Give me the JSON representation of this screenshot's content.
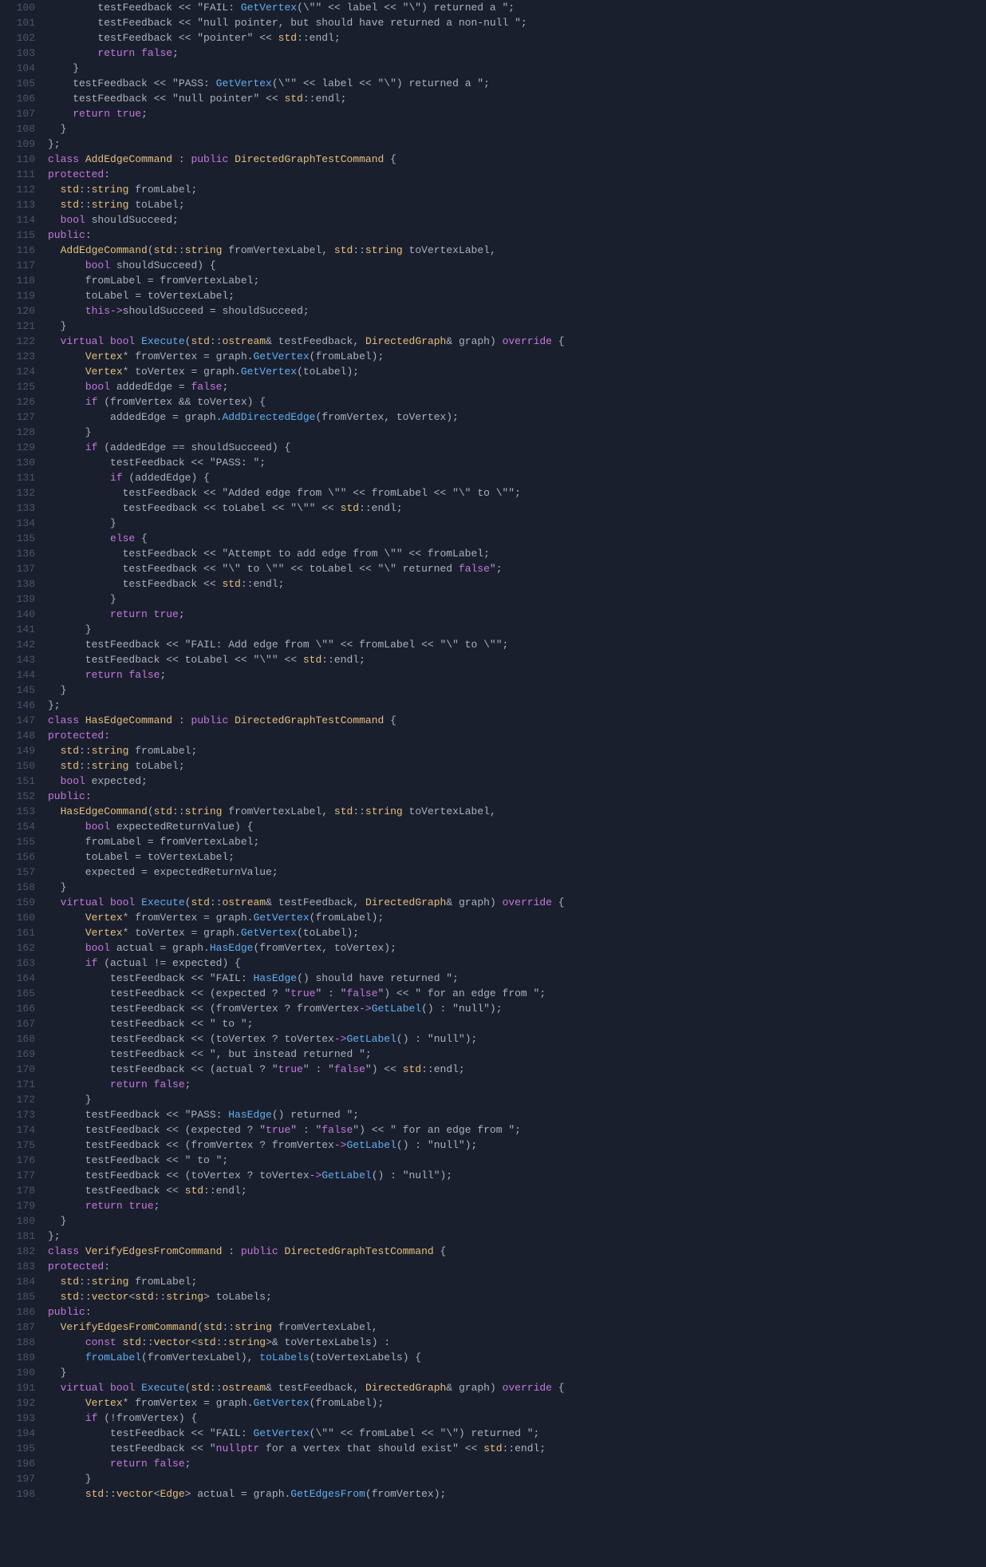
{
  "lines": [
    {
      "num": 100,
      "content": "        testFeedback << \"FAIL: GetVertex(\\\"\" << label << \"\\\") returned a \";"
    },
    {
      "num": 101,
      "content": "        testFeedback << \"null pointer, but should have returned a non-null \";"
    },
    {
      "num": 102,
      "content": "        testFeedback << \"pointer\" << std::endl;"
    },
    {
      "num": 103,
      "content": "        return false;"
    },
    {
      "num": 104,
      "content": "    }"
    },
    {
      "num": 105,
      "content": "    testFeedback << \"PASS: GetVertex(\\\"\" << label << \"\\\") returned a \";"
    },
    {
      "num": 106,
      "content": "    testFeedback << \"null pointer\" << std::endl;"
    },
    {
      "num": 107,
      "content": "    return true;"
    },
    {
      "num": 108,
      "content": "  }"
    },
    {
      "num": 109,
      "content": "};"
    },
    {
      "num": 110,
      "content": "class AddEdgeCommand : public DirectedGraphTestCommand {"
    },
    {
      "num": 111,
      "content": "protected:"
    },
    {
      "num": 112,
      "content": "  std::string fromLabel;"
    },
    {
      "num": 113,
      "content": "  std::string toLabel;"
    },
    {
      "num": 114,
      "content": "  bool shouldSucceed;"
    },
    {
      "num": 115,
      "content": "public:"
    },
    {
      "num": 116,
      "content": "  AddEdgeCommand(std::string fromVertexLabel, std::string toVertexLabel,"
    },
    {
      "num": 117,
      "content": "      bool shouldSucceed) {"
    },
    {
      "num": 118,
      "content": "      fromLabel = fromVertexLabel;"
    },
    {
      "num": 119,
      "content": "      toLabel = toVertexLabel;"
    },
    {
      "num": 120,
      "content": "      this->shouldSucceed = shouldSucceed;"
    },
    {
      "num": 121,
      "content": "  }"
    },
    {
      "num": 122,
      "content": "  virtual bool Execute(std::ostream& testFeedback, DirectedGraph& graph) override {"
    },
    {
      "num": 123,
      "content": "      Vertex* fromVertex = graph.GetVertex(fromLabel);"
    },
    {
      "num": 124,
      "content": "      Vertex* toVertex = graph.GetVertex(toLabel);"
    },
    {
      "num": 125,
      "content": "      bool addedEdge = false;"
    },
    {
      "num": 126,
      "content": "      if (fromVertex && toVertex) {"
    },
    {
      "num": 127,
      "content": "          addedEdge = graph.AddDirectedEdge(fromVertex, toVertex);"
    },
    {
      "num": 128,
      "content": "      }"
    },
    {
      "num": 129,
      "content": "      if (addedEdge == shouldSucceed) {"
    },
    {
      "num": 130,
      "content": "          testFeedback << \"PASS: \";"
    },
    {
      "num": 131,
      "content": "          if (addedEdge) {"
    },
    {
      "num": 132,
      "content": "            testFeedback << \"Added edge from \\\"\" << fromLabel << \"\\\" to \\\"\";"
    },
    {
      "num": 133,
      "content": "            testFeedback << toLabel << \"\\\"\" << std::endl;"
    },
    {
      "num": 134,
      "content": "          }"
    },
    {
      "num": 135,
      "content": "          else {"
    },
    {
      "num": 136,
      "content": "            testFeedback << \"Attempt to add edge from \\\"\" << fromLabel;"
    },
    {
      "num": 137,
      "content": "            testFeedback << \"\\\" to \\\"\" << toLabel << \"\\\" returned false\";"
    },
    {
      "num": 138,
      "content": "            testFeedback << std::endl;"
    },
    {
      "num": 139,
      "content": "          }"
    },
    {
      "num": 140,
      "content": "          return true;"
    },
    {
      "num": 141,
      "content": "      }"
    },
    {
      "num": 142,
      "content": "      testFeedback << \"FAIL: Add edge from \\\"\" << fromLabel << \"\\\" to \\\"\";"
    },
    {
      "num": 143,
      "content": "      testFeedback << toLabel << \"\\\"\" << std::endl;"
    },
    {
      "num": 144,
      "content": "      return false;"
    },
    {
      "num": 145,
      "content": "  }"
    },
    {
      "num": 146,
      "content": "};"
    },
    {
      "num": 147,
      "content": "class HasEdgeCommand : public DirectedGraphTestCommand {"
    },
    {
      "num": 148,
      "content": "protected:"
    },
    {
      "num": 149,
      "content": "  std::string fromLabel;"
    },
    {
      "num": 150,
      "content": "  std::string toLabel;"
    },
    {
      "num": 151,
      "content": "  bool expected;"
    },
    {
      "num": 152,
      "content": "public:"
    },
    {
      "num": 153,
      "content": "  HasEdgeCommand(std::string fromVertexLabel, std::string toVertexLabel,"
    },
    {
      "num": 154,
      "content": "      bool expectedReturnValue) {"
    },
    {
      "num": 155,
      "content": "      fromLabel = fromVertexLabel;"
    },
    {
      "num": 156,
      "content": "      toLabel = toVertexLabel;"
    },
    {
      "num": 157,
      "content": "      expected = expectedReturnValue;"
    },
    {
      "num": 158,
      "content": "  }"
    },
    {
      "num": 159,
      "content": "  virtual bool Execute(std::ostream& testFeedback, DirectedGraph& graph) override {"
    },
    {
      "num": 160,
      "content": "      Vertex* fromVertex = graph.GetVertex(fromLabel);"
    },
    {
      "num": 161,
      "content": "      Vertex* toVertex = graph.GetVertex(toLabel);"
    },
    {
      "num": 162,
      "content": "      bool actual = graph.HasEdge(fromVertex, toVertex);"
    },
    {
      "num": 163,
      "content": "      if (actual != expected) {"
    },
    {
      "num": 164,
      "content": "          testFeedback << \"FAIL: HasEdge() should have returned \";"
    },
    {
      "num": 165,
      "content": "          testFeedback << (expected ? \"true\" : \"false\") << \" for an edge from \";"
    },
    {
      "num": 166,
      "content": "          testFeedback << (fromVertex ? fromVertex->GetLabel() : \"null\");"
    },
    {
      "num": 167,
      "content": "          testFeedback << \" to \";"
    },
    {
      "num": 168,
      "content": "          testFeedback << (toVertex ? toVertex->GetLabel() : \"null\");"
    },
    {
      "num": 169,
      "content": "          testFeedback << \", but instead returned \";"
    },
    {
      "num": 170,
      "content": "          testFeedback << (actual ? \"true\" : \"false\") << std::endl;"
    },
    {
      "num": 171,
      "content": "          return false;"
    },
    {
      "num": 172,
      "content": "      }"
    },
    {
      "num": 173,
      "content": "      testFeedback << \"PASS: HasEdge() returned \";"
    },
    {
      "num": 174,
      "content": "      testFeedback << (expected ? \"true\" : \"false\") << \" for an edge from \";"
    },
    {
      "num": 175,
      "content": "      testFeedback << (fromVertex ? fromVertex->GetLabel() : \"null\");"
    },
    {
      "num": 176,
      "content": "      testFeedback << \" to \";"
    },
    {
      "num": 177,
      "content": "      testFeedback << (toVertex ? toVertex->GetLabel() : \"null\");"
    },
    {
      "num": 178,
      "content": "      testFeedback << std::endl;"
    },
    {
      "num": 179,
      "content": "      return true;"
    },
    {
      "num": 180,
      "content": "  }"
    },
    {
      "num": 181,
      "content": "};"
    },
    {
      "num": 182,
      "content": "class VerifyEdgesFromCommand : public DirectedGraphTestCommand {"
    },
    {
      "num": 183,
      "content": "protected:"
    },
    {
      "num": 184,
      "content": "  std::string fromLabel;"
    },
    {
      "num": 185,
      "content": "  std::vector<std::string> toLabels;"
    },
    {
      "num": 186,
      "content": "public:"
    },
    {
      "num": 187,
      "content": "  VerifyEdgesFromCommand(std::string fromVertexLabel,"
    },
    {
      "num": 188,
      "content": "      const std::vector<std::string>& toVertexLabels) :"
    },
    {
      "num": 189,
      "content": "      fromLabel(fromVertexLabel), toLabels(toVertexLabels) {"
    },
    {
      "num": 190,
      "content": "  }"
    },
    {
      "num": 191,
      "content": "  virtual bool Execute(std::ostream& testFeedback, DirectedGraph& graph) override {"
    },
    {
      "num": 192,
      "content": "      Vertex* fromVertex = graph.GetVertex(fromLabel);"
    },
    {
      "num": 193,
      "content": "      if (!fromVertex) {"
    },
    {
      "num": 194,
      "content": "          testFeedback << \"FAIL: GetVertex(\\\"\" << fromLabel << \"\\\") returned \";"
    },
    {
      "num": 195,
      "content": "          testFeedback << \"nullptr for a vertex that should exist\" << std::endl;"
    },
    {
      "num": 196,
      "content": "          return false;"
    },
    {
      "num": 197,
      "content": "      }"
    },
    {
      "num": 198,
      "content": "      std::vector<Edge> actual = graph.GetEdgesFrom(fromVertex);"
    }
  ]
}
